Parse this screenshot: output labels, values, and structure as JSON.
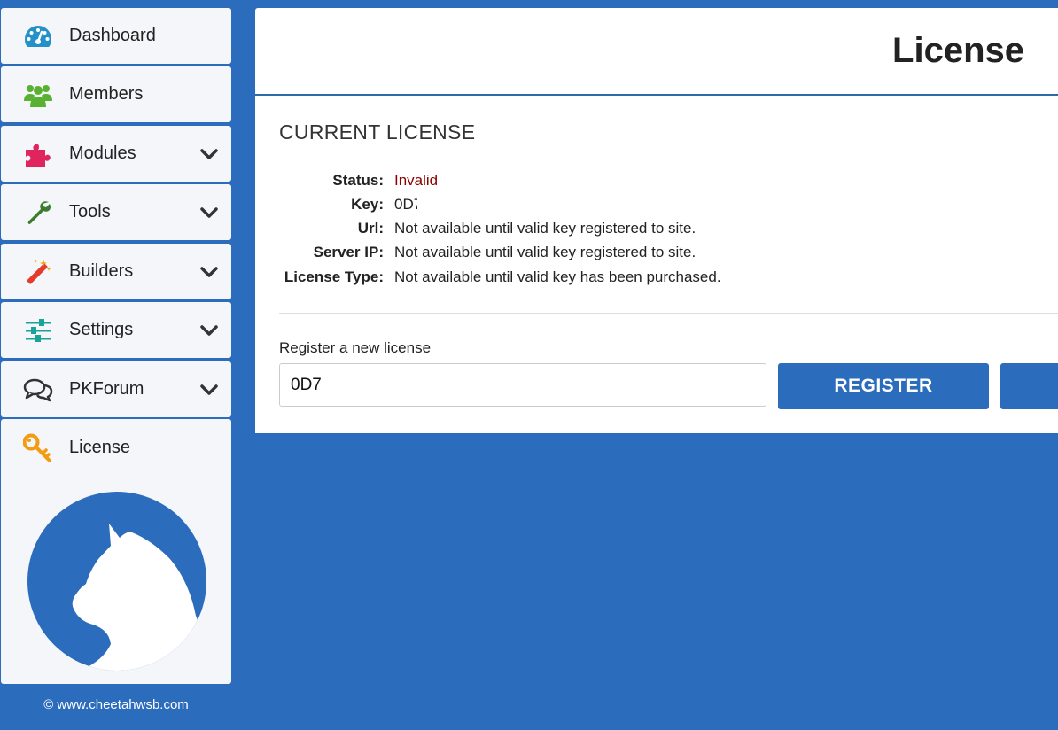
{
  "sidebar": {
    "items": [
      {
        "label": "Dashboard",
        "icon": "dashboard-gauge-icon",
        "has_submenu": false
      },
      {
        "label": "Members",
        "icon": "members-group-icon",
        "has_submenu": false
      },
      {
        "label": "Modules",
        "icon": "puzzle-piece-icon",
        "has_submenu": true
      },
      {
        "label": "Tools",
        "icon": "wrench-icon",
        "has_submenu": true
      },
      {
        "label": "Builders",
        "icon": "magic-wand-icon",
        "has_submenu": true
      },
      {
        "label": "Settings",
        "icon": "sliders-icon",
        "has_submenu": true
      },
      {
        "label": "PKForum",
        "icon": "comments-icon",
        "has_submenu": true
      },
      {
        "label": "License",
        "icon": "key-icon",
        "has_submenu": false
      }
    ],
    "footer": "© www.cheetahwsb.com"
  },
  "header": {
    "title": "License"
  },
  "license": {
    "section_title": "CURRENT LICENSE",
    "rows": [
      {
        "key": "Status:",
        "value": "Invalid"
      },
      {
        "key": "Key:",
        "value": "0D7"
      },
      {
        "key": "Url:",
        "value": "Not available until valid key registered to site."
      },
      {
        "key": "Server IP:",
        "value": "Not available until valid key registered to site."
      },
      {
        "key": "License Type:",
        "value": "Not available until valid key has been purchased."
      }
    ]
  },
  "form": {
    "label": "Register a new license",
    "input_value": "0D7",
    "register_label": "REGISTER"
  },
  "colors": {
    "background": "#2b6cbd",
    "panel": "#ffffff",
    "sidebar_item": "#f4f6f9",
    "status_invalid": "#8b0000",
    "button": "#2b6cbd"
  }
}
